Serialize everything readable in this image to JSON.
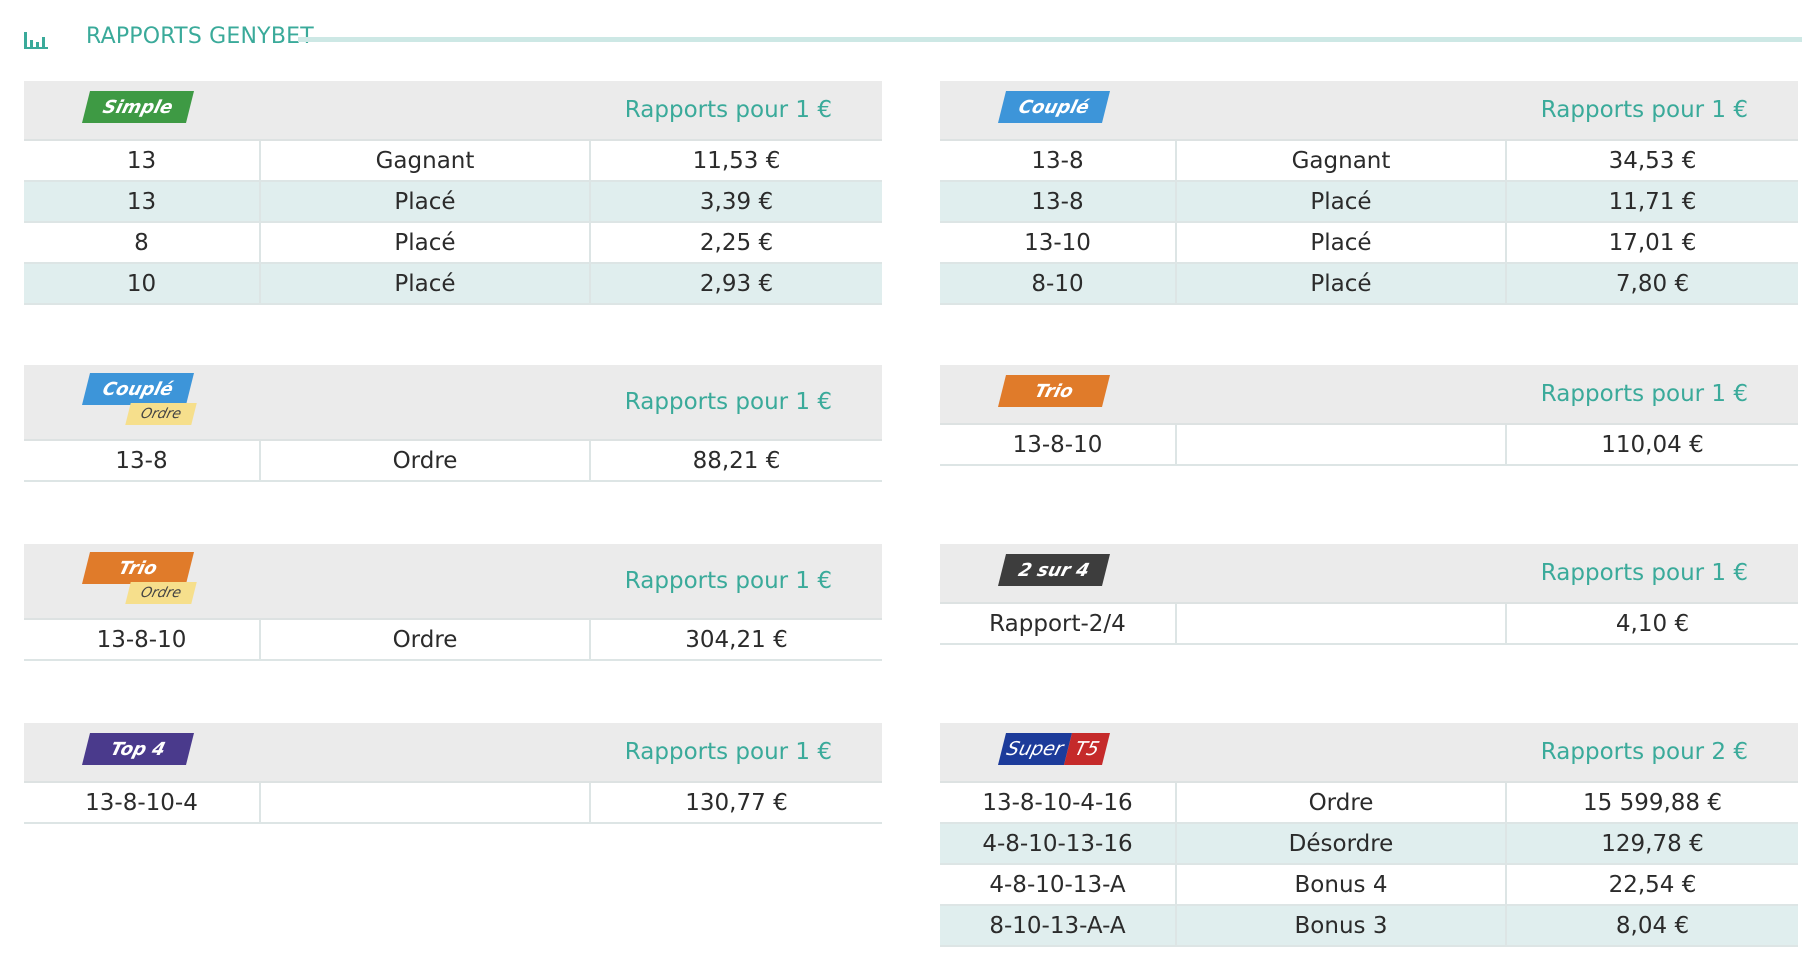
{
  "header": {
    "title": "RAPPORTS GENYBET",
    "icon": "bar-chart-icon"
  },
  "colors": {
    "accent": "#3aaa9a",
    "simple": "#3e9a44",
    "couple": "#3d95d9",
    "trio": "#e07b2a",
    "deux_sur_quatre": "#3d3d3d",
    "top4": "#4a3a8c",
    "super_blue": "#1c3b9a",
    "super_red": "#c52a2a",
    "ordre_tag": "#f6df8c"
  },
  "panels": {
    "simple": {
      "badge": "Simple",
      "label": "Rapports pour 1 €",
      "rows": [
        [
          "13",
          "Gagnant",
          "11,53 €"
        ],
        [
          "13",
          "Placé",
          "3,39 €"
        ],
        [
          "8",
          "Placé",
          "2,25 €"
        ],
        [
          "10",
          "Placé",
          "2,93 €"
        ]
      ]
    },
    "couple": {
      "badge": "Couplé",
      "label": "Rapports pour 1 €",
      "rows": [
        [
          "13-8",
          "Gagnant",
          "34,53 €"
        ],
        [
          "13-8",
          "Placé",
          "11,71 €"
        ],
        [
          "13-10",
          "Placé",
          "17,01 €"
        ],
        [
          "8-10",
          "Placé",
          "7,80 €"
        ]
      ]
    },
    "couple_ordre": {
      "badge": "Couplé",
      "sub": "Ordre",
      "label": "Rapports pour 1 €",
      "rows": [
        [
          "13-8",
          "Ordre",
          "88,21 €"
        ]
      ]
    },
    "trio": {
      "badge": "Trio",
      "label": "Rapports pour 1 €",
      "rows": [
        [
          "13-8-10",
          "",
          "110,04 €"
        ]
      ]
    },
    "trio_ordre": {
      "badge": "Trio",
      "sub": "Ordre",
      "label": "Rapports pour 1 €",
      "rows": [
        [
          "13-8-10",
          "Ordre",
          "304,21 €"
        ]
      ]
    },
    "deux_sur_quatre": {
      "badge": "2 sur 4",
      "label": "Rapports pour 1 €",
      "rows": [
        [
          "Rapport-2/4",
          "",
          "4,10 €"
        ]
      ]
    },
    "top4": {
      "badge": "Top 4",
      "label": "Rapports pour 1 €",
      "rows": [
        [
          "13-8-10-4",
          "",
          "130,77 €"
        ]
      ]
    },
    "super_t5": {
      "badge_left": "Super",
      "badge_right": "T5",
      "label": "Rapports pour 2 €",
      "rows": [
        [
          "13-8-10-4-16",
          "Ordre",
          "15 599,88 €"
        ],
        [
          "4-8-10-13-16",
          "Désordre",
          "129,78 €"
        ],
        [
          "4-8-10-13-A",
          "Bonus 4",
          "22,54 €"
        ],
        [
          "8-10-13-A-A",
          "Bonus 3",
          "8,04 €"
        ]
      ]
    }
  }
}
